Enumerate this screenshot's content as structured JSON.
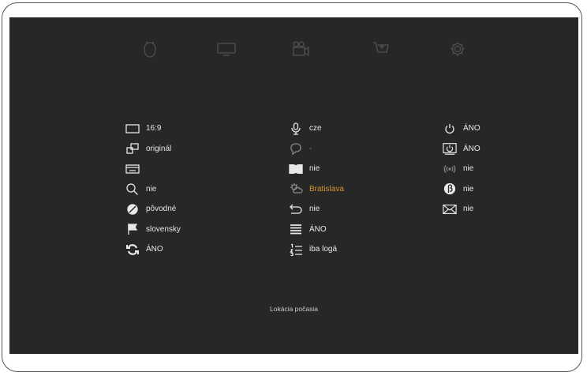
{
  "nav": [
    {
      "icon": "remote-control-icon"
    },
    {
      "icon": "tv-icon"
    },
    {
      "icon": "video-camera-icon"
    },
    {
      "icon": "shopping-cart-icon"
    },
    {
      "icon": "gear-icon"
    }
  ],
  "columns": {
    "left": [
      {
        "icon": "aspect-ratio-icon",
        "value": "16:9"
      },
      {
        "icon": "picture-format-icon",
        "value": "originál"
      },
      {
        "icon": "subtitle-box-icon",
        "value": ""
      },
      {
        "icon": "zoom-icon",
        "value": "nie"
      },
      {
        "icon": "color-contrast-icon",
        "value": "pôvodné"
      },
      {
        "icon": "flag-icon",
        "value": "slovensky"
      },
      {
        "icon": "refresh-icon",
        "value": "ÁNO"
      }
    ],
    "middle": [
      {
        "icon": "microphone-icon",
        "value": "cze"
      },
      {
        "icon": "speech-bubble-icon",
        "value": "-"
      },
      {
        "icon": "dolby-icon",
        "value": "nie"
      },
      {
        "icon": "weather-icon",
        "value": "Bratislava"
      },
      {
        "icon": "return-arrow-icon",
        "value": "nie"
      },
      {
        "icon": "list-icon",
        "value": "ÁNO"
      },
      {
        "icon": "numbered-list-icon",
        "value": "iba logá"
      }
    ],
    "right": [
      {
        "icon": "power-icon",
        "value": "ÁNO"
      },
      {
        "icon": "power-box-icon",
        "value": "ÁNO"
      },
      {
        "icon": "wireless-icon",
        "value": "nie"
      },
      {
        "icon": "beta-icon",
        "value": "nie"
      },
      {
        "icon": "envelope-icon",
        "value": "nie"
      }
    ]
  },
  "footer": {
    "label": "Lokácia počasia"
  },
  "colors": {
    "background": "#262827",
    "accent": "#d9922e",
    "text": "#e6e6e6"
  }
}
